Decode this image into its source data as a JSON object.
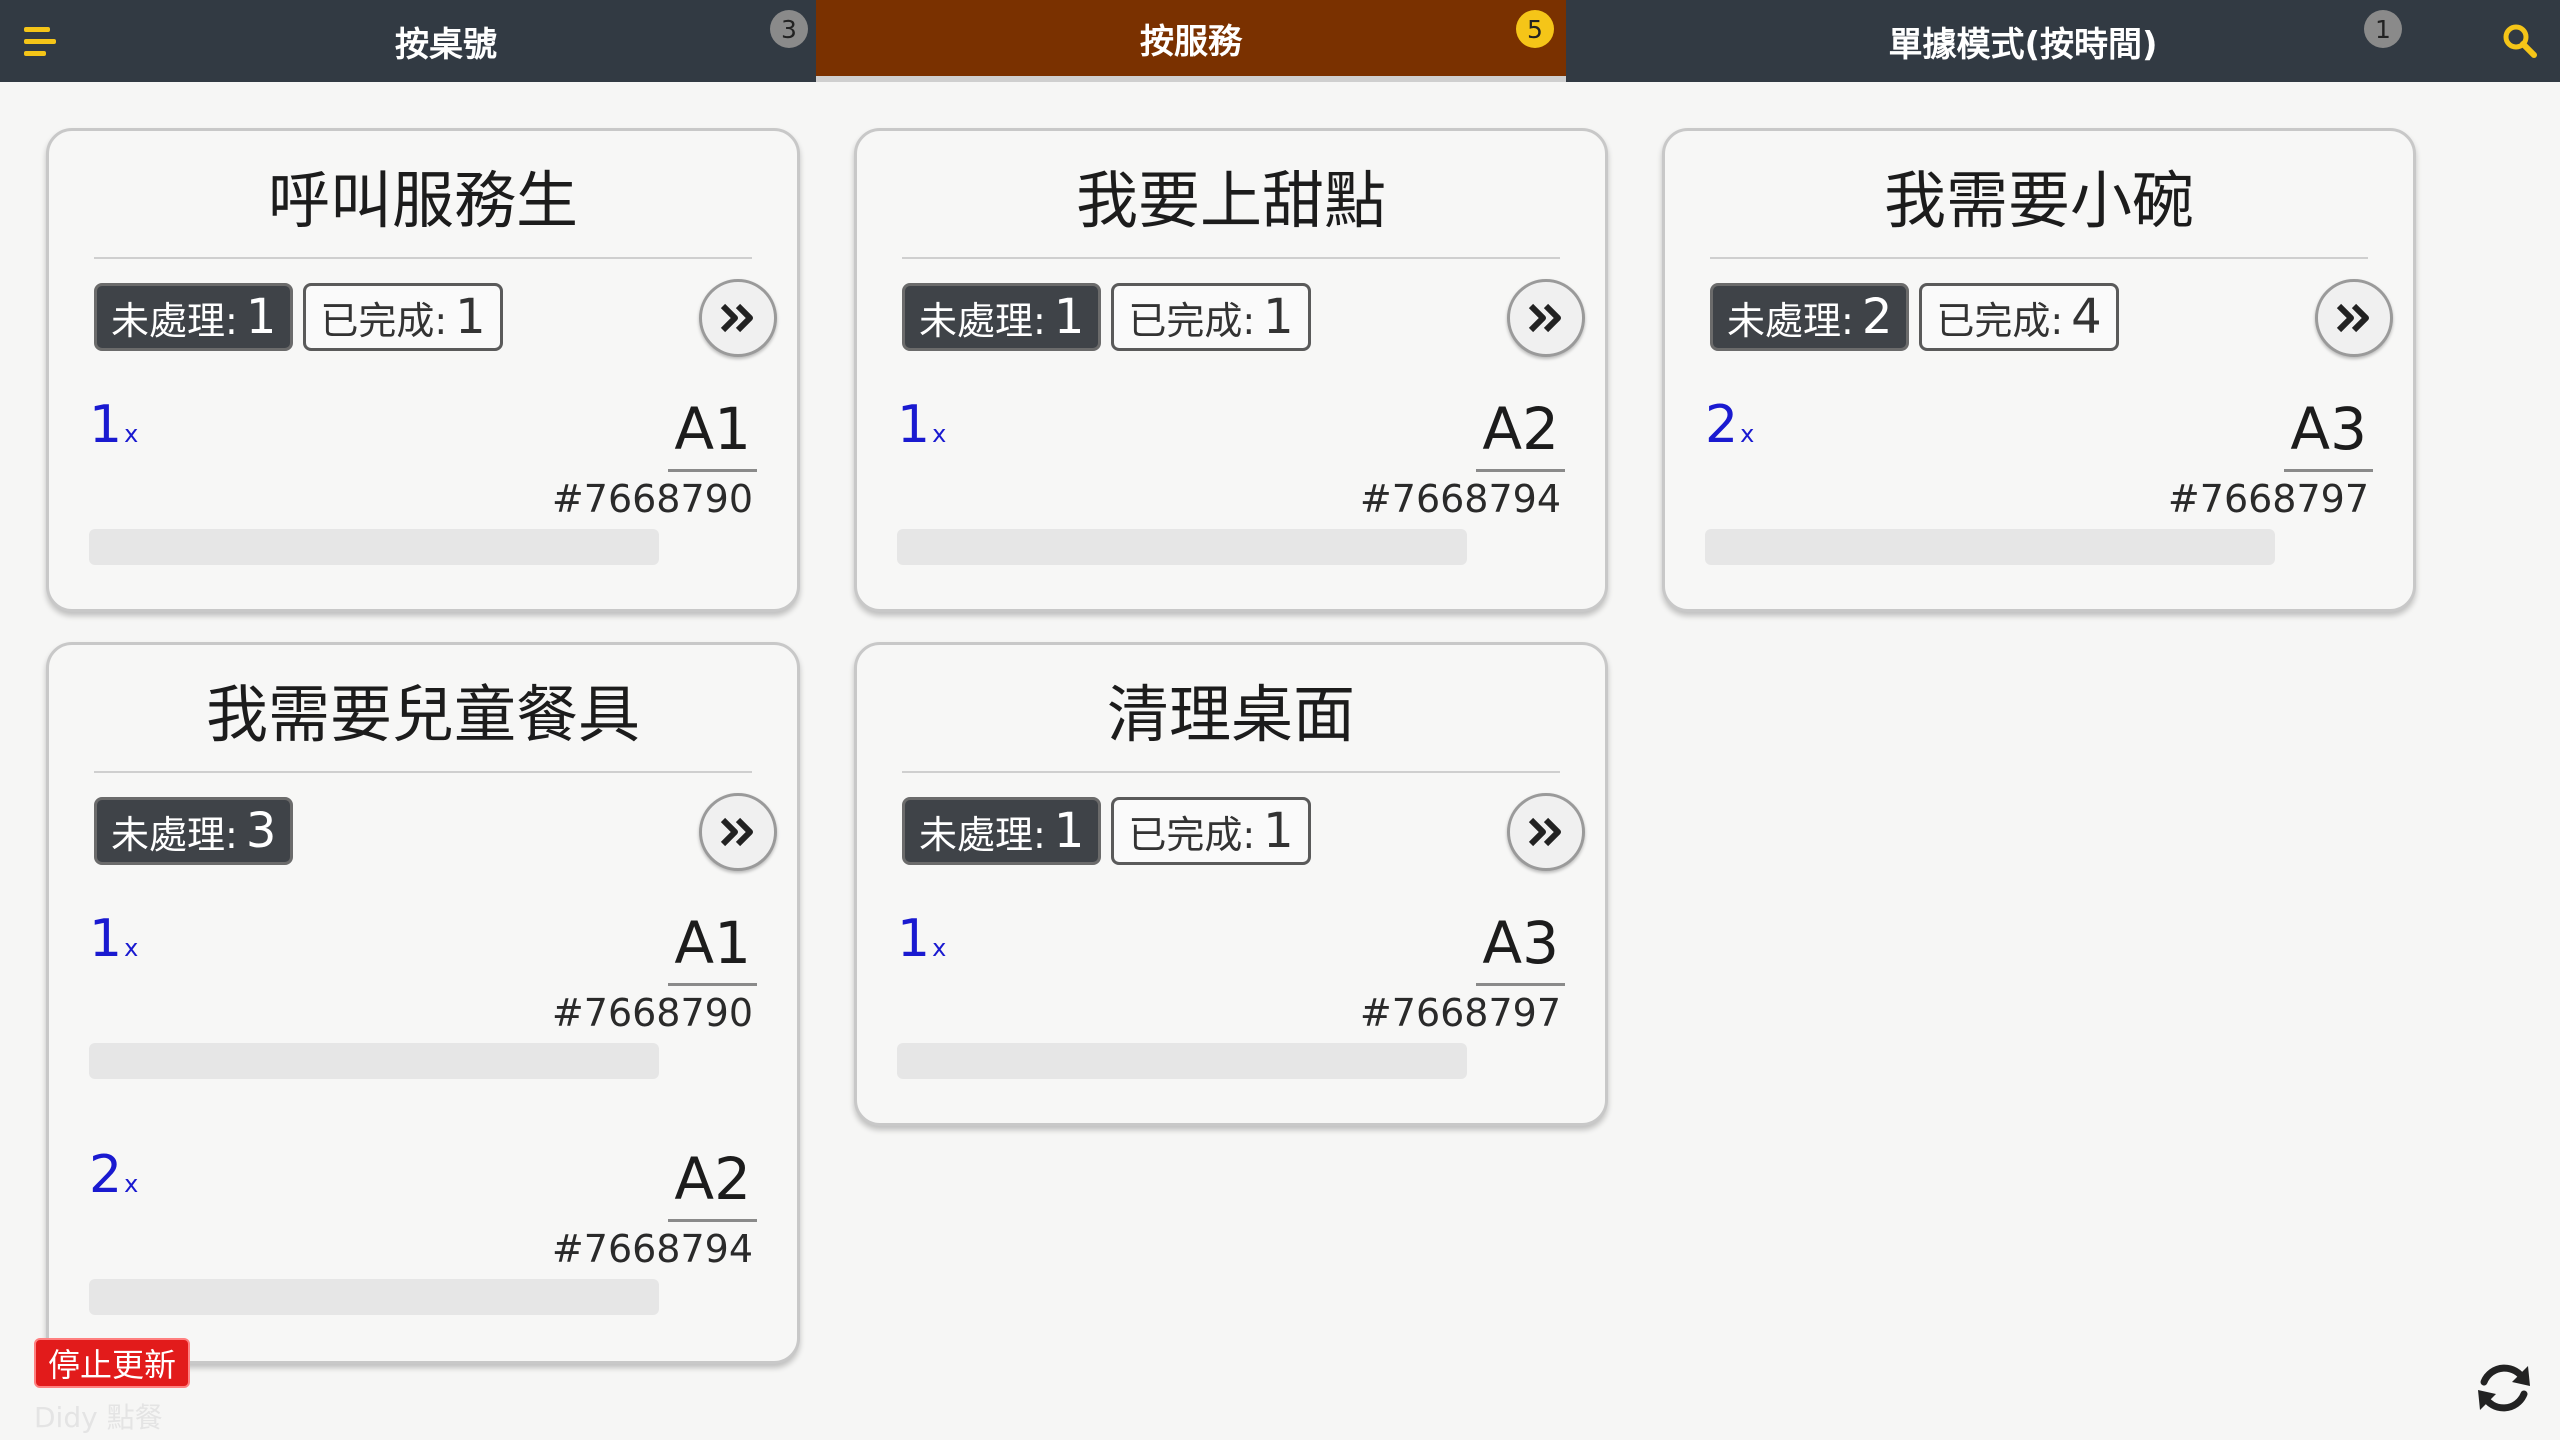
{
  "tabs": [
    {
      "label": "按桌號",
      "badge": "3"
    },
    {
      "label": "按服務",
      "badge": "5"
    },
    {
      "label": "單據模式(按時間)",
      "badge": "1"
    }
  ],
  "labels": {
    "pending": "未處理:",
    "done": "已完成:",
    "qty_suffix": "x"
  },
  "cards": [
    {
      "title": "呼叫服務生",
      "pending": "1",
      "done": "1",
      "entries": [
        {
          "qty": "1",
          "table": "A1",
          "order": "#7668790"
        }
      ]
    },
    {
      "title": "我要上甜點",
      "pending": "1",
      "done": "1",
      "entries": [
        {
          "qty": "1",
          "table": "A2",
          "order": "#7668794"
        }
      ]
    },
    {
      "title": "我需要小碗",
      "pending": "2",
      "done": "4",
      "entries": [
        {
          "qty": "2",
          "table": "A3",
          "order": "#7668797"
        }
      ]
    },
    {
      "title": "我需要兒童餐具",
      "pending": "3",
      "done": null,
      "entries": [
        {
          "qty": "1",
          "table": "A1",
          "order": "#7668790"
        },
        {
          "qty": "2",
          "table": "A2",
          "order": "#7668794"
        }
      ]
    },
    {
      "title": "清理桌面",
      "pending": "1",
      "done": "1",
      "entries": [
        {
          "qty": "1",
          "table": "A3",
          "order": "#7668797"
        }
      ]
    }
  ],
  "footer": {
    "stop_label": "停止更新",
    "watermark": "Didy 點餐"
  },
  "colors": {
    "topbar": "#323a43",
    "active_tab": "#7a3100",
    "badge_active": "#f5c518",
    "qty_blue": "#1a1ad0",
    "stop_red": "#e21b1b"
  },
  "icons": {
    "menu": "menu-icon",
    "search": "search-icon",
    "forward": "double-chevron-right-icon",
    "refresh": "refresh-icon"
  }
}
